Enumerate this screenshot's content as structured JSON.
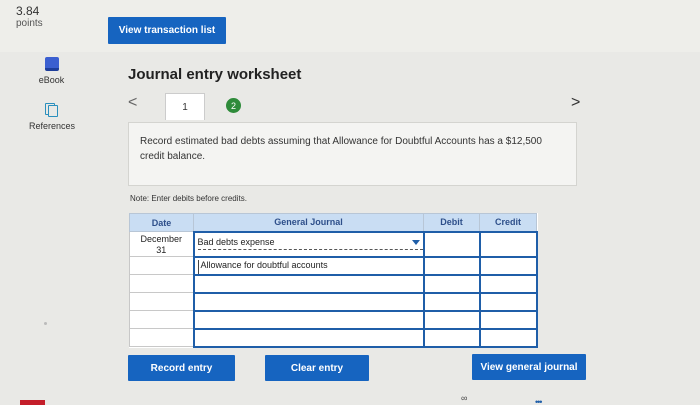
{
  "points": {
    "value": "3.84",
    "label": "points"
  },
  "toolbar": {
    "view_transaction_list": "View transaction list"
  },
  "sidebar": {
    "items": [
      {
        "label": "eBook",
        "icon": "book-icon"
      },
      {
        "label": "References",
        "icon": "references-icon"
      }
    ]
  },
  "worksheet": {
    "title": "Journal entry worksheet",
    "nav": {
      "prev": "<",
      "next": ">"
    },
    "tabs": [
      {
        "label": "1",
        "active": true
      },
      {
        "label": "2",
        "active": false,
        "color": "#2e8b3a"
      }
    ],
    "instruction": "Record estimated bad debts assuming that Allowance for Doubtful Accounts has a $12,500 credit balance.",
    "note": "Note: Enter debits before credits."
  },
  "journal": {
    "headers": {
      "date": "Date",
      "general_journal": "General Journal",
      "debit": "Debit",
      "credit": "Credit"
    },
    "rows": [
      {
        "date_line1": "December",
        "date_line2": "31",
        "account": "Bad debts expense",
        "debit": "",
        "credit": ""
      },
      {
        "date_line1": "",
        "date_line2": "",
        "account": "Allowance for doubtful accounts",
        "debit": "",
        "credit": ""
      },
      {
        "date_line1": "",
        "date_line2": "",
        "account": "",
        "debit": "",
        "credit": ""
      },
      {
        "date_line1": "",
        "date_line2": "",
        "account": "",
        "debit": "",
        "credit": ""
      },
      {
        "date_line1": "",
        "date_line2": "",
        "account": "",
        "debit": "",
        "credit": ""
      },
      {
        "date_line1": "",
        "date_line2": "",
        "account": "",
        "debit": "",
        "credit": ""
      }
    ]
  },
  "actions": {
    "record_entry": "Record entry",
    "clear_entry": "Clear entry",
    "view_general_journal": "View general journal"
  },
  "colors": {
    "primary_button": "#1664c0",
    "table_header": "#c9ddf3",
    "input_border": "#1f5ea8"
  }
}
